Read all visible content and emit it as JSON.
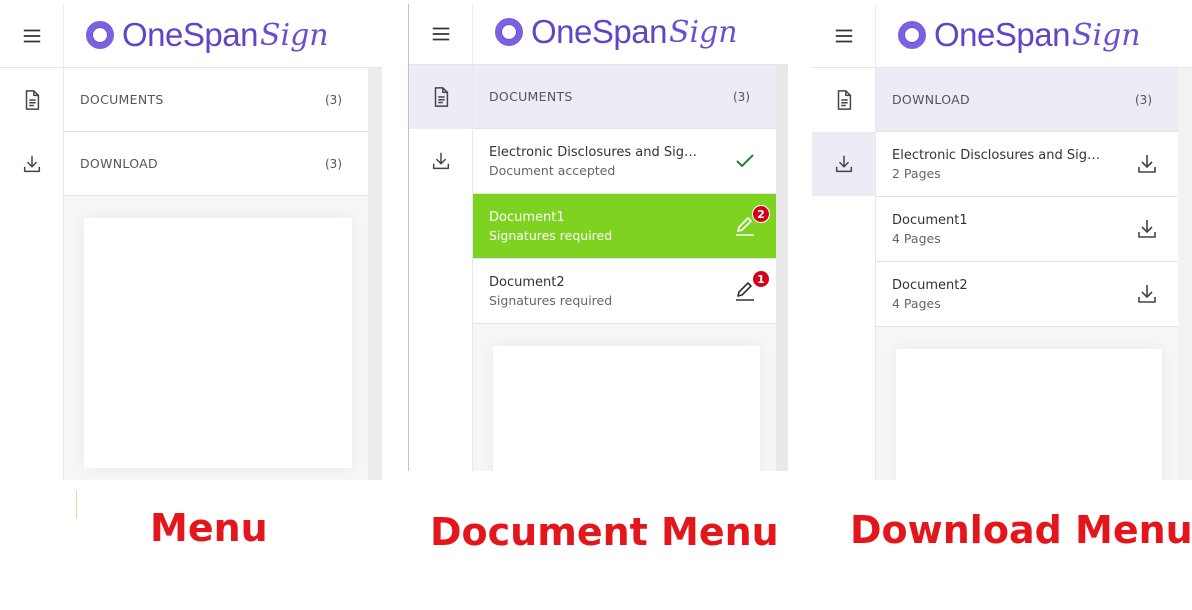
{
  "brand": {
    "name": "OneSpan",
    "script": "Sign",
    "color": "#5f46c9"
  },
  "colors": {
    "active_bg": "#ecebf6",
    "current_doc": "#7ed321",
    "badge": "#d0021b",
    "caption": "#e3161c",
    "check": "#2e7d32"
  },
  "panels": [
    {
      "caption": "Menu",
      "rail": [
        {
          "icon": "document-icon"
        },
        {
          "icon": "download-icon"
        }
      ],
      "sections": [
        {
          "title": "DOCUMENTS",
          "count": "(3)"
        },
        {
          "title": "DOWNLOAD",
          "count": "(3)"
        }
      ]
    },
    {
      "caption": "Document Menu",
      "rail": [
        {
          "icon": "document-icon",
          "active": true
        },
        {
          "icon": "download-icon"
        }
      ],
      "section": {
        "title": "DOCUMENTS",
        "count": "(3)"
      },
      "documents": [
        {
          "name": "Electronic Disclosures and Signatures Consent",
          "sub": "Document accepted",
          "icon": "check-icon"
        },
        {
          "name": "Document1",
          "sub": "Signatures required",
          "icon": "pen-icon",
          "badge": "2",
          "current": true
        },
        {
          "name": "Document2",
          "sub": "Signatures required",
          "icon": "pen-icon",
          "badge": "1"
        }
      ]
    },
    {
      "caption": "Download Menu",
      "rail": [
        {
          "icon": "document-icon"
        },
        {
          "icon": "download-icon",
          "active": true
        }
      ],
      "section": {
        "title": "DOWNLOAD",
        "count": "(3)"
      },
      "documents": [
        {
          "name": "Electronic Disclosures and Signatures Consent",
          "sub": "2 Pages",
          "icon": "download-icon"
        },
        {
          "name": "Document1",
          "sub": "4 Pages",
          "icon": "download-icon"
        },
        {
          "name": "Document2",
          "sub": "4 Pages",
          "icon": "download-icon"
        }
      ]
    }
  ]
}
